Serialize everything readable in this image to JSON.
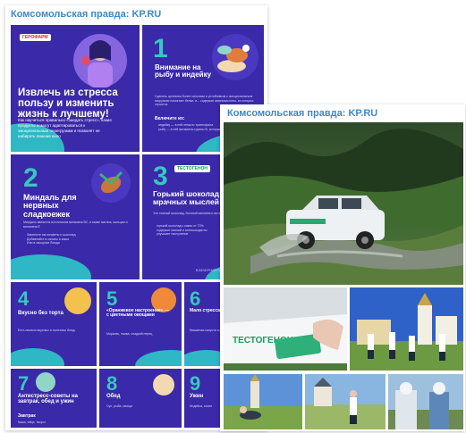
{
  "left_card": {
    "title": "Комсомольская правда: KP.RU",
    "slides": [
      {
        "number": "",
        "logo": "ГЕРОФАРМ",
        "title": "Извлечь из стресса пользу и изменить жизнь к лучшему!",
        "body": "Как научиться правильно «заедать стресс», какие продукты помогут адаптироваться к эмоциональным перегрузкам и позволят не набирать лишние кило"
      },
      {
        "number": "1",
        "title": "Внимание на рыбу и индейку",
        "body": "Сделать организм более сильным и устойчивым к эмоциональным нагрузкам помогают белки, и... содержат аминокислоты, из которых строятся",
        "subhead": "Включите их:",
        "bullets": [
          "индейку — в ней немало триптофана",
          "рыбу — в ней витамины группы B, которые помогают организму"
        ]
      },
      {
        "number": "2",
        "title": "Миндаль для нервных сладкоежек",
        "body": "Миндаль является источником витамина B2, а также магния, кальция и витамина E",
        "bullets": [
          "Замените им конфеты и шоколад",
          "Добавляйте в салаты и каши",
          "Или в овощные блюда"
        ]
      },
      {
        "number": "3",
        "logo": "ТЕСТОГЕНОН",
        "title": "Горький шоколад от мрачных мыслей",
        "body": "Это темный шоколад, богатый магнием и антиоксидантами",
        "bullets": [
          "горький шоколад с какао от 70%",
          "содержит магний и антиоксиданты",
          "улучшает настроение"
        ],
        "footer": "В ВЕЧЕРНИЙ ПЕРЕКУС"
      },
      {
        "number": "4",
        "title": "Вкусно без торта",
        "body": "Есть немало вкусных и полезных блюд"
      },
      {
        "number": "5",
        "title": "«Оранжевое настроение» — с цветными овощами",
        "body": "Морковь, тыква, сладкий перец"
      },
      {
        "number": "6",
        "title": "Мало стресса — рыбки капуста",
        "body": "Квашеная капуста и рыба"
      },
      {
        "number": "7",
        "title": "Антистресс-советы на завтрак, обед и ужин",
        "subhead": "Завтрак",
        "body": "Каша, яйца, творог"
      },
      {
        "number": "8",
        "title": "Обед",
        "body": "Суп, рыба, овощи"
      },
      {
        "number": "9",
        "title": "Ужин",
        "body": "Индейка, салат"
      }
    ]
  },
  "right_card": {
    "title": "Комсомольская правда: KP.RU",
    "photos": [
      {
        "name": "suv-driving-through-water",
        "caption": ""
      },
      {
        "name": "car-door-tesstogenon-card",
        "brand": "ТЕСТОГЕНОН"
      },
      {
        "name": "runners-near-cathedral"
      },
      {
        "name": "participants-on-grass"
      },
      {
        "name": "participant-with-poles"
      },
      {
        "name": "participants-in-helmets"
      }
    ]
  },
  "colors": {
    "slide_bg": "#3a29a8",
    "accent_teal": "#2fb7c5",
    "title_blue": "#3d88c9"
  }
}
